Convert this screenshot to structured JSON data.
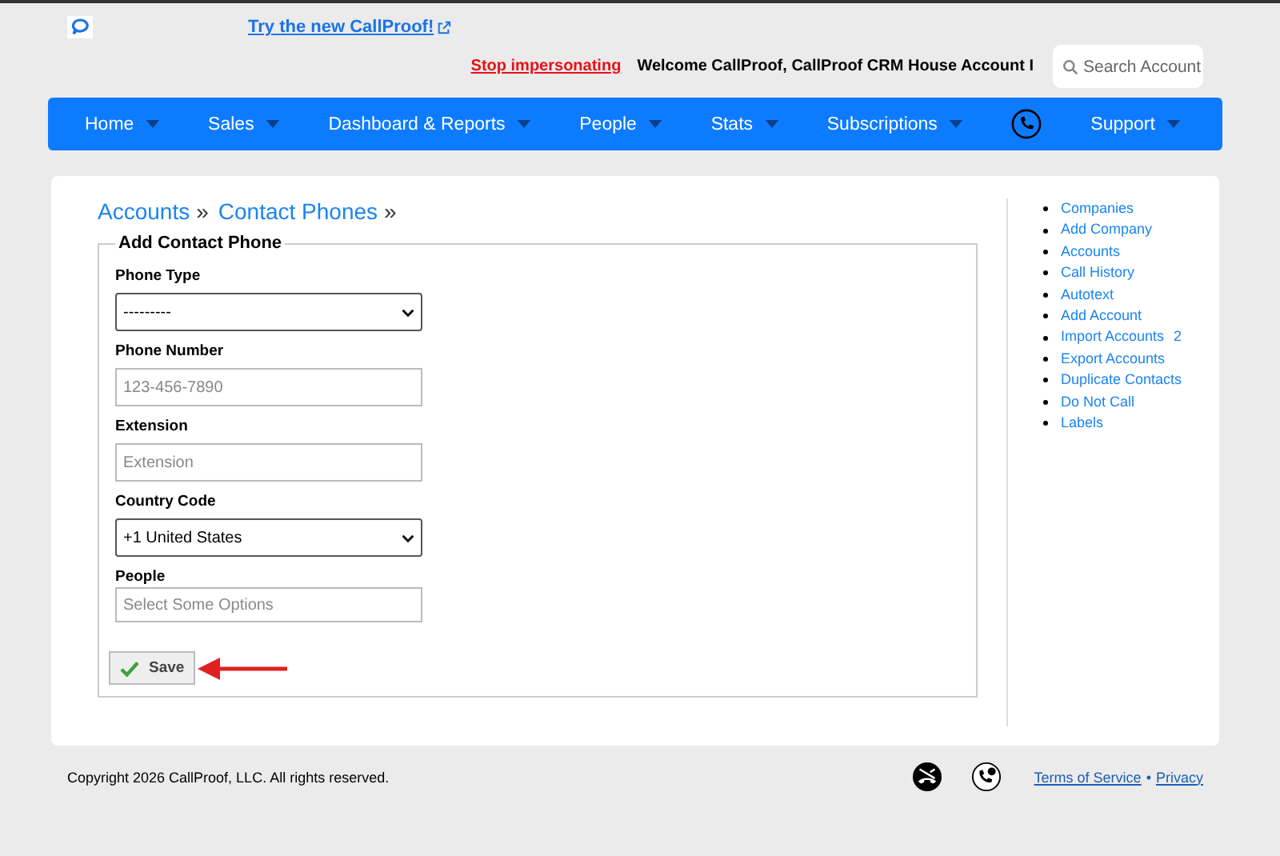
{
  "header": {
    "promo_link": "Try the new CallProof!",
    "stop_link": "Stop impersonating",
    "welcome": "Welcome CallProof, CallProof CRM House Account I",
    "search": {
      "placeholder": "Search Account"
    }
  },
  "nav": [
    {
      "label": "Home",
      "kind": "menu"
    },
    {
      "label": "Sales",
      "kind": "menu"
    },
    {
      "label": "Dashboard & Reports",
      "kind": "menu"
    },
    {
      "label": "People",
      "kind": "menu"
    },
    {
      "label": "Stats",
      "kind": "menu"
    },
    {
      "label": "Subscriptions",
      "kind": "menu"
    },
    {
      "kind": "phone"
    },
    {
      "label": "Support",
      "kind": "menu"
    }
  ],
  "breadcrumb": [
    {
      "label": "Accounts",
      "separator": "»"
    },
    {
      "label": "Contact Phones",
      "separator": "»"
    }
  ],
  "form": {
    "legend": "Add Contact Phone",
    "fields": [
      {
        "label": "Phone Type",
        "kind": "select",
        "value": "---------"
      },
      {
        "label": "Phone Number",
        "kind": "input",
        "placeholder": "123-456-7890"
      },
      {
        "label": "Extension",
        "kind": "input",
        "placeholder": "Extension"
      },
      {
        "label": "Country Code",
        "kind": "select",
        "value": "+1 United States"
      },
      {
        "label": "People",
        "kind": "multi",
        "placeholder": "Select Some Options"
      }
    ],
    "save": "Save"
  },
  "sidebar": {
    "items": [
      {
        "label": "Companies"
      },
      {
        "label": "Add Company"
      },
      {
        "label": "Accounts"
      },
      {
        "label": "Call History"
      },
      {
        "label": "Autotext"
      },
      {
        "label": "Add Account"
      },
      {
        "label": "Import Accounts",
        "count": "2"
      },
      {
        "label": "Export Accounts"
      },
      {
        "label": "Duplicate Contacts"
      },
      {
        "label": "Do Not Call"
      },
      {
        "label": "Labels"
      }
    ]
  },
  "footer": {
    "copyright": "Copyright 2026 CallProof, LLC. All rights reserved.",
    "links": [
      "Terms of Service",
      "Privacy"
    ],
    "link_separator": "•"
  }
}
